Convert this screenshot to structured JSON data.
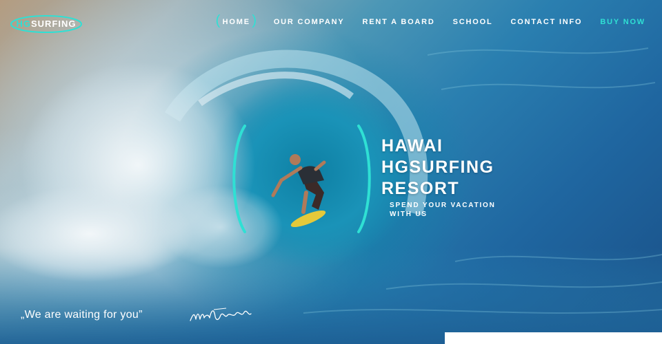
{
  "logo": {
    "prefix": "HG",
    "suffix": "SURFING",
    "accent_color": "#2fe0d4"
  },
  "nav": {
    "items": [
      {
        "label": "HOME",
        "active": true
      },
      {
        "label": "OUR COMPANY"
      },
      {
        "label": "RENT A BOARD"
      },
      {
        "label": "SCHOOL"
      },
      {
        "label": "CONTACT INFO"
      }
    ],
    "cta": "BUY NOW"
  },
  "hero": {
    "title_lines": [
      "HAWAI",
      "HGSURFING",
      "RESORT"
    ],
    "subtitle_lines": [
      "SPEND YOUR VACATION",
      "WITH US"
    ],
    "tagline": "„We are waiting for you”",
    "image": "surfer-in-wave-barrel"
  },
  "colors": {
    "accent": "#2fe0d4",
    "text": "#ffffff"
  }
}
